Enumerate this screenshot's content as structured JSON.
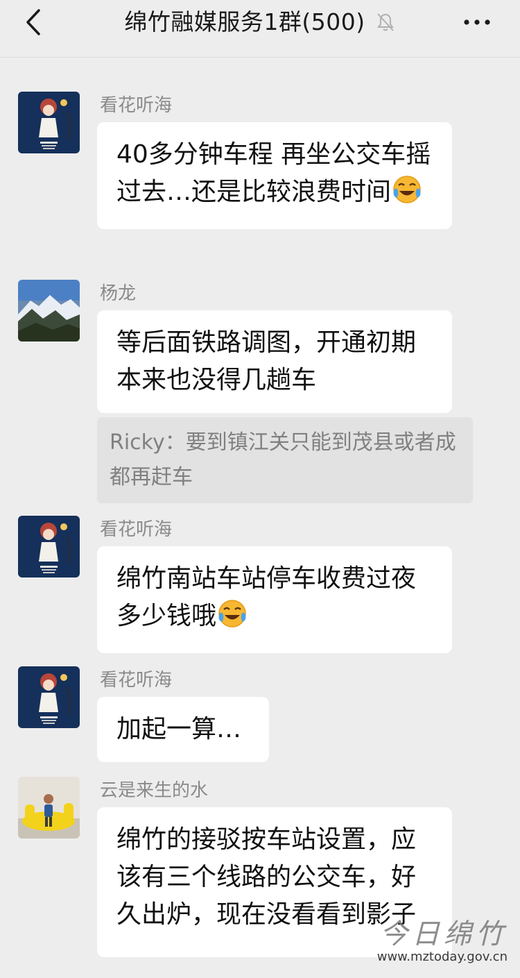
{
  "header": {
    "title": "绵竹融媒服务1群(500)",
    "back_icon": "chevron-left-icon",
    "mute_icon": "bell-off-icon",
    "more_icon": "more-horizontal-icon"
  },
  "messages": [
    {
      "sender": "看花听海",
      "avatar": "illustrated-girl-avatar",
      "text": "40多分钟车程  再坐公交车摇过去…还是比较浪费时间",
      "emoji": "crying-laughing-emoji"
    },
    {
      "sender": "杨龙",
      "avatar": "mountain-landscape-avatar",
      "text": "等后面铁路调图，开通初期本来也没得几趟车",
      "quote": "Ricky：要到镇江关只能到茂县或者成都再赶车"
    },
    {
      "sender": "看花听海",
      "avatar": "illustrated-girl-avatar",
      "text": "绵竹南站车站停车收费过夜多少钱哦",
      "emoji": "crying-laughing-emoji"
    },
    {
      "sender": "看花听海",
      "avatar": "illustrated-girl-avatar",
      "text": "加起一算…"
    },
    {
      "sender": "云是来生的水",
      "avatar": "child-yellow-toy-avatar",
      "text": "绵竹的接驳按车站设置，应该有三个线路的公交车，好久出炉，现在没看看到影子"
    }
  ],
  "watermark": {
    "logo": "今日绵竹",
    "url": "www.mztoday.gov.cn"
  }
}
